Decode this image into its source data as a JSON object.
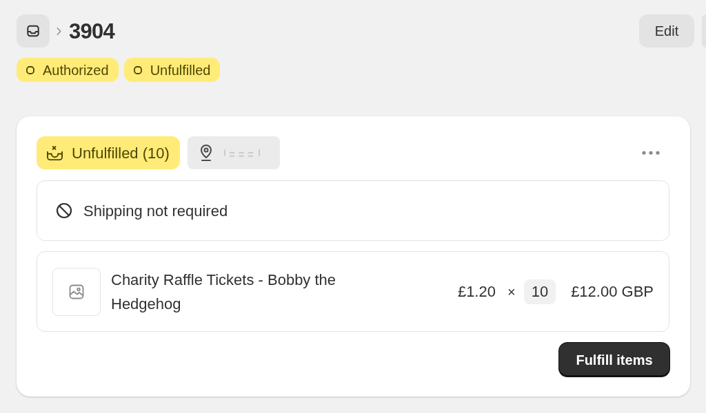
{
  "header": {
    "title": "3904",
    "actions": [
      {
        "label": "Edit"
      }
    ]
  },
  "badges": [
    {
      "label": "Authorized"
    },
    {
      "label": "Unfulfilled"
    }
  ],
  "fulfillment_card": {
    "status_label": "Unfulfilled (10)",
    "shipping_note": "Shipping not required",
    "line_items": [
      {
        "title": "Charity Raffle Tickets - Bobby the Hedgehog",
        "unit_price": "£1.20",
        "multiply_sign": "×",
        "quantity": "10",
        "total": "£12.00 GBP"
      }
    ],
    "primary_action": "Fulfill items"
  }
}
